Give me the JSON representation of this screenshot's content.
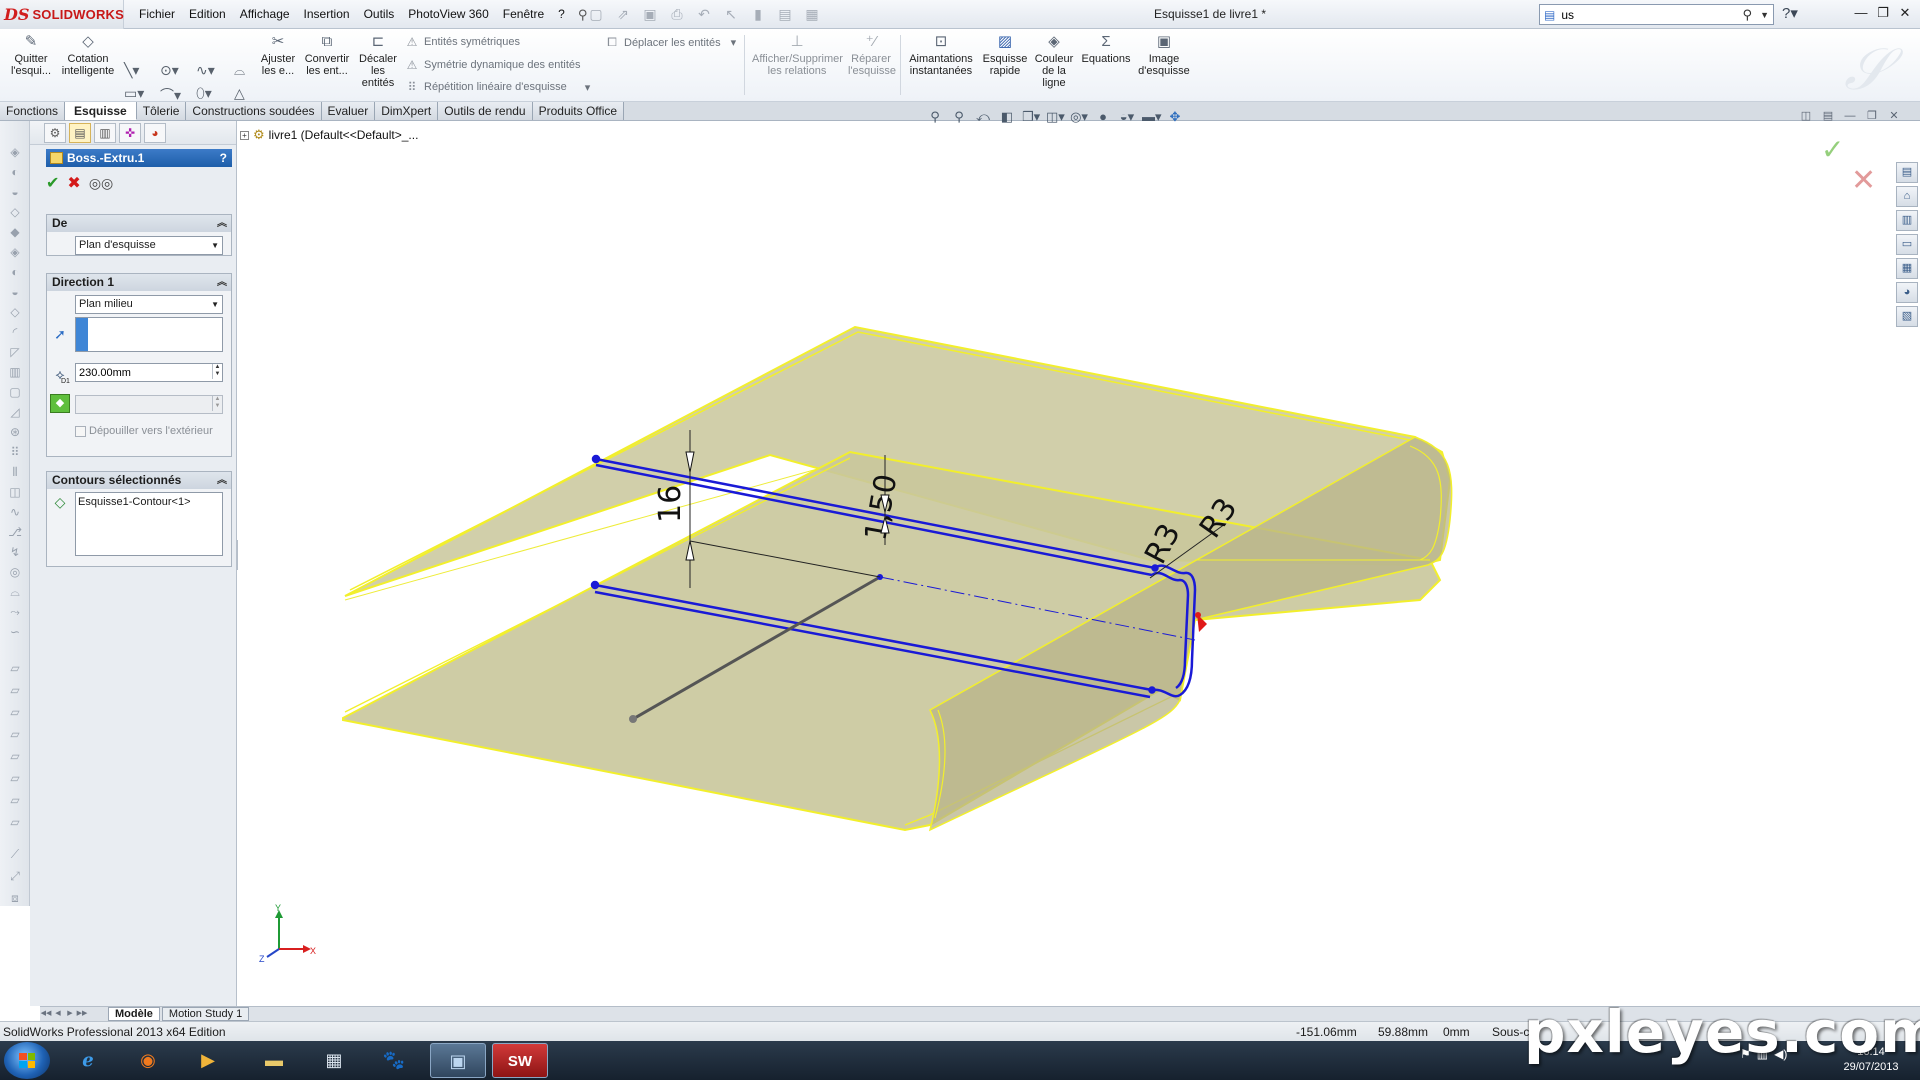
{
  "app": {
    "logo_mark": "DS",
    "logo_text": "SOLIDWORKS",
    "document_title": "Esquisse1 de livre1 *",
    "brand_color": "#c81818"
  },
  "menu": [
    "Fichier",
    "Edition",
    "Affichage",
    "Insertion",
    "Outils",
    "PhotoView 360",
    "Fenêtre",
    "?"
  ],
  "search": {
    "value": "us",
    "placeholder": ""
  },
  "command_manager": {
    "exit_sketch": "Quitter l'esqui...",
    "smart_dimension": "Cotation intelligente",
    "trim": "Ajuster les e...",
    "convert": "Convertir les ent...",
    "offset": "Décaler les entités",
    "mirror": "Entités symétriques",
    "dynamic_mirror": "Symétrie dynamique des entités",
    "linear_pattern": "Répétition linéaire d'esquisse",
    "move": "Déplacer les entités",
    "relations": "Afficher/Supprimer les relations",
    "repair": "Réparer l'esquisse",
    "snaps": "Aimantations instantanées",
    "rapid_sketch": "Esquisse rapide",
    "line_color": "Couleur de la ligne",
    "equations": "Equations",
    "sketch_picture": "Image d'esquisse"
  },
  "cm_tabs": [
    "Fonctions",
    "Esquisse",
    "Tôlerie",
    "Constructions soudées",
    "Evaluer",
    "DimXpert",
    "Outils de rendu",
    "Produits Office"
  ],
  "cm_active_tab": "Esquisse",
  "property_manager": {
    "title": "Boss.-Extru.1",
    "help": "?",
    "group_from": {
      "title": "De",
      "start_condition": "Plan d'esquisse"
    },
    "group_direction1": {
      "title": "Direction 1",
      "end_condition": "Plan milieu",
      "depth_value": "230.00mm",
      "depth_symbol": "D1",
      "draft_value": "",
      "draft_outward_label": "Dépouiller vers l'extérieur"
    },
    "group_contours": {
      "title": "Contours sélectionnés",
      "items": [
        "Esquisse1-Contour<1>"
      ]
    }
  },
  "tree_flyout": {
    "label": "livre1  (Default<<Default>_..."
  },
  "dimensions": {
    "thickness": "16",
    "wall": "1,50",
    "radius_a": "R3",
    "radius_b": "R3"
  },
  "triad": {
    "y": "Y",
    "x": "X",
    "z": "Z"
  },
  "model_tabs": [
    "Modèle",
    "Motion Study 1"
  ],
  "model_active_tab": "Modèle",
  "status": {
    "product": "SolidWorks Professional 2013 x64 Edition",
    "x": "-151.06mm",
    "y": "59.88mm",
    "z": "0mm",
    "state": "Sous-c"
  },
  "clock": {
    "time": "16:14",
    "date": "29/07/2013"
  },
  "watermark": "pxleyes.com",
  "colors": {
    "part_fill": "#c8c89a",
    "part_edge": "#f5f32a",
    "sketch": "#1a1ad6",
    "selection_blue": "#2b6cc4"
  }
}
